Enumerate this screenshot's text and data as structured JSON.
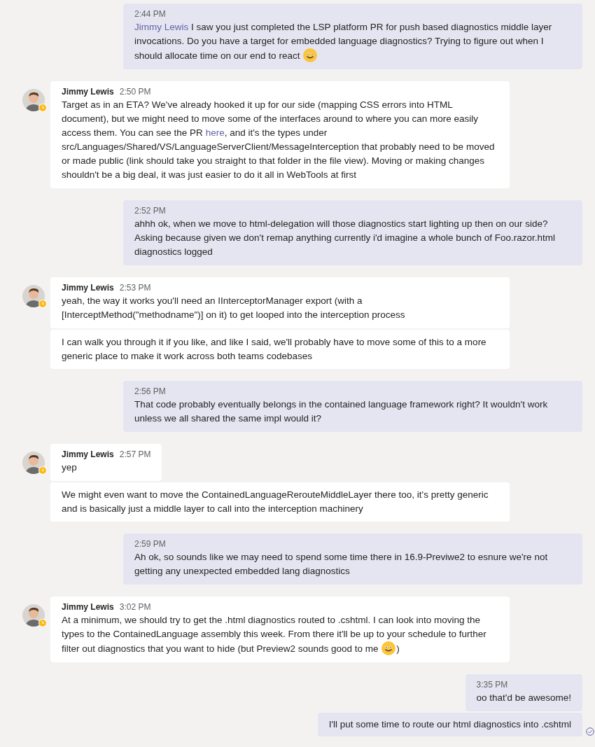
{
  "messages": [
    {
      "kind": "sent",
      "items": [
        {
          "time": "2:44 PM",
          "parts": [
            {
              "kind": "mention",
              "text": "Jimmy Lewis"
            },
            {
              "kind": "text",
              "text": " I saw you just completed the LSP platform PR for push based diagnostics middle layer invocations. Do you have a target for embedded language diagnostics? Trying to figure out when I should allocate time on our end to react "
            },
            {
              "kind": "emoji"
            }
          ]
        }
      ]
    },
    {
      "kind": "received",
      "author": "Jimmy Lewis",
      "away": true,
      "items": [
        {
          "time": "2:50 PM",
          "parts": [
            {
              "kind": "text",
              "text": "Target as in an ETA?  We've already hooked it up for our side (mapping CSS errors into HTML document), but we might need to move some of the interfaces around to where you can more easily access them.  You can see the PR "
            },
            {
              "kind": "link",
              "text": "here"
            },
            {
              "kind": "text",
              "text": ", and it's the types under src/Languages/Shared/VS/LanguageServerClient/MessageInterception that probably need to be moved or made public (link should take you straight to that folder in the file view).  Moving or making changes shouldn't be a big deal, it was just easier to do it all in WebTools at first"
            }
          ]
        }
      ]
    },
    {
      "kind": "sent",
      "items": [
        {
          "time": "2:52 PM",
          "parts": [
            {
              "kind": "text",
              "text": "ahhh ok, when we move to html-delegation will those diagnostics start lighting up then on our side? Asking because given we don't remap anything currently i'd imagine a whole bunch of Foo.razor.html diagnostics logged"
            }
          ]
        }
      ]
    },
    {
      "kind": "received",
      "author": "Jimmy Lewis",
      "away": true,
      "items": [
        {
          "time": "2:53 PM",
          "parts": [
            {
              "kind": "text",
              "text": "yeah, the way it works you'll need an IInterceptorManager export (with a [InterceptMethod(\"methodname\")] on it) to get looped into the interception process"
            }
          ]
        },
        {
          "parts": [
            {
              "kind": "text",
              "text": "I can walk you through it if you like, and like I said, we'll probably have to move some of this to a more generic place to make it work across both teams codebases"
            }
          ]
        }
      ]
    },
    {
      "kind": "sent",
      "items": [
        {
          "time": "2:56 PM",
          "parts": [
            {
              "kind": "text",
              "text": "That code probably eventually belongs in the contained language framework right? It wouldn't work unless we all shared the same impl would it?"
            }
          ]
        }
      ]
    },
    {
      "kind": "received",
      "author": "Jimmy Lewis",
      "away": true,
      "items": [
        {
          "time": "2:57 PM",
          "parts": [
            {
              "kind": "text",
              "text": "yep"
            }
          ]
        },
        {
          "parts": [
            {
              "kind": "text",
              "text": "We might even want to move the ContainedLanguageRerouteMiddleLayer there too, it's pretty generic and is basically just a middle layer to call into the interception machinery"
            }
          ]
        }
      ]
    },
    {
      "kind": "sent",
      "items": [
        {
          "time": "2:59 PM",
          "parts": [
            {
              "kind": "text",
              "text": "Ah ok, so sounds like we may need to spend some time there in 16.9-Previwe2 to esnure we're not getting any unexpected embedded lang diagnostics"
            }
          ]
        }
      ]
    },
    {
      "kind": "received",
      "author": "Jimmy Lewis",
      "away": true,
      "items": [
        {
          "time": "3:02 PM",
          "parts": [
            {
              "kind": "text",
              "text": "At a minimum, we should try to get the .html diagnostics routed to .cshtml.  I can look into moving the types to the ContainedLanguage assembly this week.  From there it'll be up to your schedule to further filter out diagnostics that you want to hide (but Preview2 sounds good to me "
            },
            {
              "kind": "emoji"
            },
            {
              "kind": "text",
              "text": ")"
            }
          ]
        }
      ]
    },
    {
      "kind": "sent",
      "items": [
        {
          "time": "3:35 PM",
          "parts": [
            {
              "kind": "text",
              "text": "oo that'd be awesome!"
            }
          ]
        },
        {
          "sent": true,
          "parts": [
            {
              "kind": "text",
              "text": "I'll put some time to route our html diagnostics into .cshtml"
            }
          ]
        }
      ]
    }
  ]
}
